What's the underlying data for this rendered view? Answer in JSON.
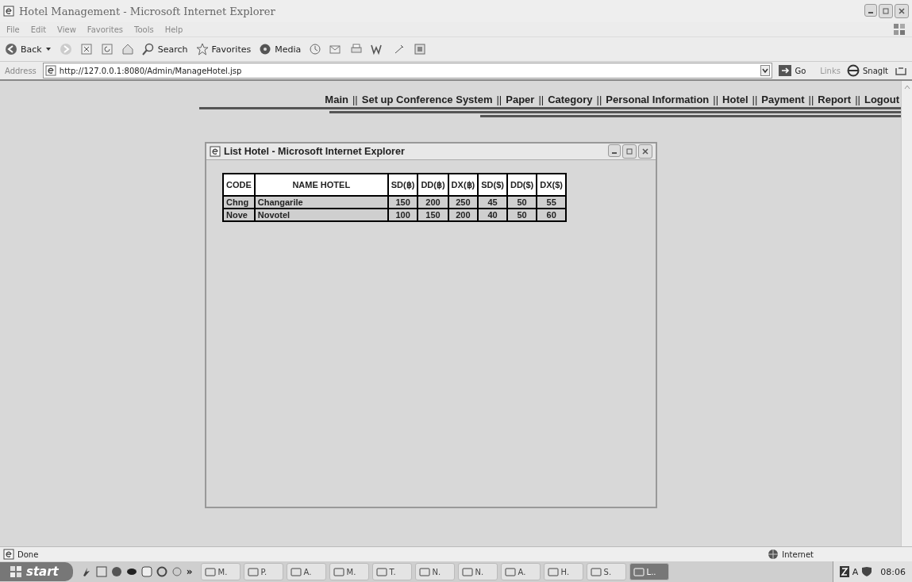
{
  "window": {
    "title": "Hotel Management - Microsoft Internet Explorer"
  },
  "menu": [
    "File",
    "Edit",
    "View",
    "Favorites",
    "Tools",
    "Help"
  ],
  "toolbar": [
    {
      "kind": "back",
      "label": "Back"
    },
    {
      "kind": "search",
      "label": "Search"
    },
    {
      "kind": "favorites",
      "label": "Favorites"
    },
    {
      "kind": "media",
      "label": "Media"
    }
  ],
  "address": {
    "label": "Address",
    "value": "http://127.0.0.1:8080/Admin/ManageHotel.jsp",
    "go": "Go",
    "links": "Links",
    "snagit": "SnagIt"
  },
  "nav": [
    "Main",
    "Set up Conference System",
    "Paper",
    "Category",
    "Personal Information",
    "Hotel",
    "Payment",
    "Report",
    "Logout"
  ],
  "nav_separator": "||",
  "popup": {
    "title": "List Hotel - Microsoft Internet Explorer",
    "table": {
      "columns": [
        "CODE",
        "NAME HOTEL",
        "SD(฿)",
        "DD(฿)",
        "DX(฿)",
        "SD($)",
        "DD($)",
        "DX($)"
      ],
      "rows": [
        [
          "Chng",
          "Changarile",
          "150",
          "200",
          "250",
          "45",
          "50",
          "55"
        ],
        [
          "Nove",
          "Novotel",
          "100",
          "150",
          "200",
          "40",
          "50",
          "60"
        ]
      ]
    }
  },
  "status_bar": {
    "text": "Done",
    "zone": "Internet"
  },
  "taskbar": {
    "start": "start",
    "more": "»",
    "tasks": [
      {
        "label": "M.",
        "selected": false
      },
      {
        "label": "P.",
        "selected": false
      },
      {
        "label": "A.",
        "selected": false
      },
      {
        "label": "M.",
        "selected": false
      },
      {
        "label": "T.",
        "selected": false
      },
      {
        "label": "N.",
        "selected": false
      },
      {
        "label": "N.",
        "selected": false
      },
      {
        "label": "A.",
        "selected": false
      },
      {
        "label": "H.",
        "selected": false
      },
      {
        "label": "S.",
        "selected": false
      },
      {
        "label": "L..",
        "selected": true
      }
    ],
    "tray": "A",
    "time": "08:06"
  }
}
